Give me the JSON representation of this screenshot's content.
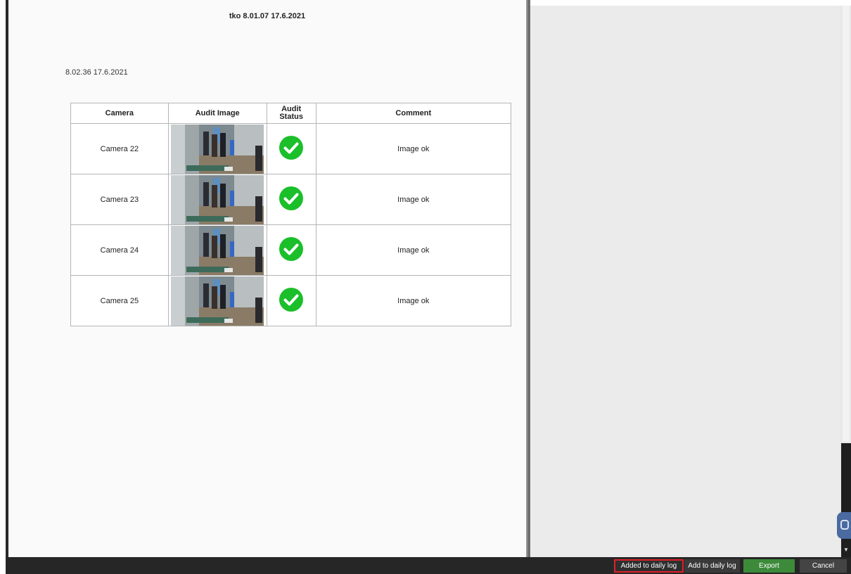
{
  "document": {
    "title": "tko 8.01.07 17.6.2021",
    "subtitle": "8.02.36 17.6.2021"
  },
  "table": {
    "headers": {
      "camera": "Camera",
      "audit_image": "Audit Image",
      "audit_status": "Audit Status",
      "comment": "Comment"
    },
    "rows": [
      {
        "camera": "Camera 22",
        "status": "ok",
        "comment": "Image ok"
      },
      {
        "camera": "Camera 23",
        "status": "ok",
        "comment": "Image ok"
      },
      {
        "camera": "Camera 24",
        "status": "ok",
        "comment": "Image ok"
      },
      {
        "camera": "Camera 25",
        "status": "ok",
        "comment": "Image ok"
      }
    ]
  },
  "toolbar": {
    "added_label": "Added to daily log",
    "add_label": "Add to daily log",
    "export_label": "Export",
    "cancel_label": "Cancel"
  },
  "icons": {
    "status": "check-circle-icon",
    "side_tab": "panel-toggle-icon"
  },
  "colors": {
    "status_ok": "#1bbf2a",
    "export_button": "#3d8a3a",
    "highlight_border": "#e0202a"
  }
}
